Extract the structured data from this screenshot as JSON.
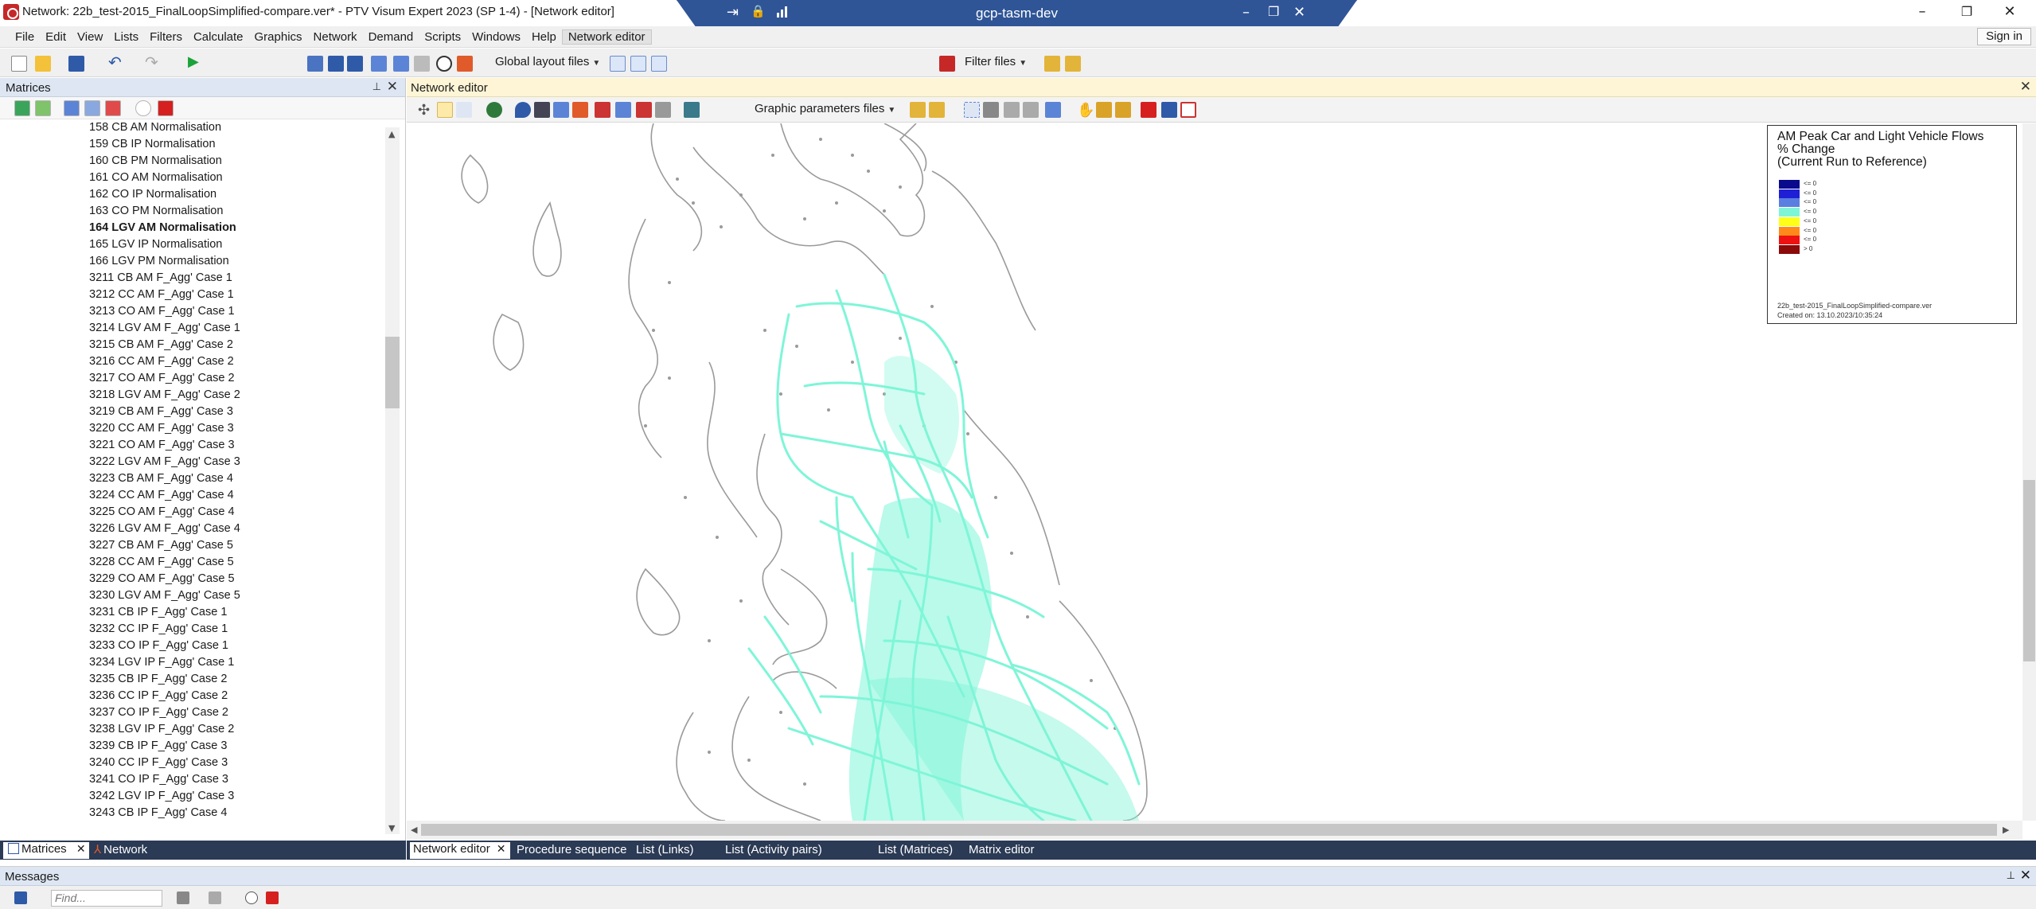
{
  "window": {
    "title": "Network: 22b_test-2015_FinalLoopSimplified-compare.ver* - PTV Visum Expert 2023 (SP 1-4) - [Network editor]",
    "minimize": "–",
    "restore": "❐",
    "close": "✕"
  },
  "remote": {
    "title": "gcp-tasm-dev",
    "pin_icon": "⇥",
    "lock_icon": "🔒",
    "signal_icon": "▮",
    "minimize": "–",
    "restore": "❐",
    "close": "✕"
  },
  "menu": {
    "items": [
      "File",
      "Edit",
      "View",
      "Lists",
      "Filters",
      "Calculate",
      "Graphics",
      "Network",
      "Demand",
      "Scripts",
      "Windows",
      "Help",
      "Network editor"
    ],
    "active_index": 12,
    "sign_in": "Sign in"
  },
  "toolbar": {
    "global_layout_files": "Global layout files",
    "filter_files": "Filter files"
  },
  "matrices_panel": {
    "title": "Matrices",
    "pin": "📌",
    "close": "✕",
    "items": [
      {
        "label": "158 CB AM Normalisation",
        "bold": false
      },
      {
        "label": "159 CB IP Normalisation",
        "bold": false
      },
      {
        "label": "160 CB PM Normalisation",
        "bold": false
      },
      {
        "label": "161 CO AM Normalisation",
        "bold": false
      },
      {
        "label": "162 CO IP Normalisation",
        "bold": false
      },
      {
        "label": "163 CO PM Normalisation",
        "bold": false
      },
      {
        "label": "164 LGV AM Normalisation",
        "bold": true
      },
      {
        "label": "165 LGV IP Normalisation",
        "bold": false
      },
      {
        "label": "166 LGV PM Normalisation",
        "bold": false
      },
      {
        "label": "3211 CB AM F_Agg' Case 1",
        "bold": false
      },
      {
        "label": "3212 CC AM F_Agg' Case 1",
        "bold": false
      },
      {
        "label": "3213 CO AM F_Agg' Case 1",
        "bold": false
      },
      {
        "label": "3214 LGV AM F_Agg' Case 1",
        "bold": false
      },
      {
        "label": "3215 CB AM F_Agg' Case 2",
        "bold": false
      },
      {
        "label": "3216 CC AM F_Agg' Case 2",
        "bold": false
      },
      {
        "label": "3217 CO AM F_Agg' Case 2",
        "bold": false
      },
      {
        "label": "3218 LGV AM F_Agg' Case 2",
        "bold": false
      },
      {
        "label": "3219 CB AM F_Agg' Case 3",
        "bold": false
      },
      {
        "label": "3220 CC AM F_Agg' Case 3",
        "bold": false
      },
      {
        "label": "3221 CO AM F_Agg' Case 3",
        "bold": false
      },
      {
        "label": "3222 LGV AM F_Agg' Case 3",
        "bold": false
      },
      {
        "label": "3223 CB AM F_Agg' Case 4",
        "bold": false
      },
      {
        "label": "3224 CC AM F_Agg' Case 4",
        "bold": false
      },
      {
        "label": "3225 CO AM F_Agg' Case 4",
        "bold": false
      },
      {
        "label": "3226 LGV AM F_Agg' Case 4",
        "bold": false
      },
      {
        "label": "3227 CB AM F_Agg' Case 5",
        "bold": false
      },
      {
        "label": "3228 CC AM F_Agg' Case 5",
        "bold": false
      },
      {
        "label": "3229 CO AM F_Agg' Case 5",
        "bold": false
      },
      {
        "label": "3230 LGV AM F_Agg' Case 5",
        "bold": false
      },
      {
        "label": "3231 CB IP F_Agg' Case 1",
        "bold": false
      },
      {
        "label": "3232 CC IP F_Agg' Case 1",
        "bold": false
      },
      {
        "label": "3233 CO IP F_Agg' Case 1",
        "bold": false
      },
      {
        "label": "3234 LGV IP F_Agg' Case 1",
        "bold": false
      },
      {
        "label": "3235 CB IP F_Agg' Case 2",
        "bold": false
      },
      {
        "label": "3236 CC IP F_Agg' Case 2",
        "bold": false
      },
      {
        "label": "3237 CO IP F_Agg' Case 2",
        "bold": false
      },
      {
        "label": "3238 LGV IP F_Agg' Case 2",
        "bold": false
      },
      {
        "label": "3239 CB IP F_Agg' Case 3",
        "bold": false
      },
      {
        "label": "3240 CC IP F_Agg' Case 3",
        "bold": false
      },
      {
        "label": "3241 CO IP F_Agg' Case 3",
        "bold": false
      },
      {
        "label": "3242 LGV IP F_Agg' Case 3",
        "bold": false
      },
      {
        "label": "3243 CB IP F_Agg' Case 4",
        "bold": false
      }
    ]
  },
  "left_tabs": {
    "matrices": "Matrices",
    "network": "Network"
  },
  "network_editor": {
    "title": "Network editor",
    "close": "✕",
    "graphic_parameters_files": "Graphic parameters files"
  },
  "legend": {
    "title": "AM Peak Car and Light Vehicle Flows\n% Change\n(Current Run to Reference)",
    "entries": [
      {
        "label": "<= 0",
        "color": "#0a0a8c"
      },
      {
        "label": "<= 0",
        "color": "#1f1fd6"
      },
      {
        "label": "<= 0",
        "color": "#5b7fe0"
      },
      {
        "label": "<= 0",
        "color": "#7ff5d8"
      },
      {
        "label": "<= 0",
        "color": "#ffff1a"
      },
      {
        "label": "<= 0",
        "color": "#ff8a1a"
      },
      {
        "label": "<= 0",
        "color": "#ee1111"
      },
      {
        "label": "> 0",
        "color": "#8b0a0a"
      }
    ],
    "footer": "22b_test-2015_FinalLoopSimplified-compare.ver\nCreated on: 13.10.2023/10:35:24"
  },
  "doc_tabs": {
    "items": [
      "Network editor",
      "Procedure sequence",
      "List (Links)",
      "List (Activity pairs)",
      "List (Matrices)",
      "Matrix editor"
    ],
    "active_index": 0
  },
  "messages": {
    "title": "Messages",
    "find_placeholder": "Find..."
  },
  "colors": {
    "flow_links": "#7ff5d8",
    "coastline": "#9a9a9a",
    "panel_header": "#dde6f2",
    "editor_header": "#fdf5d6",
    "tabbar": "#2b3a55",
    "remote_bar": "#2f5597"
  }
}
